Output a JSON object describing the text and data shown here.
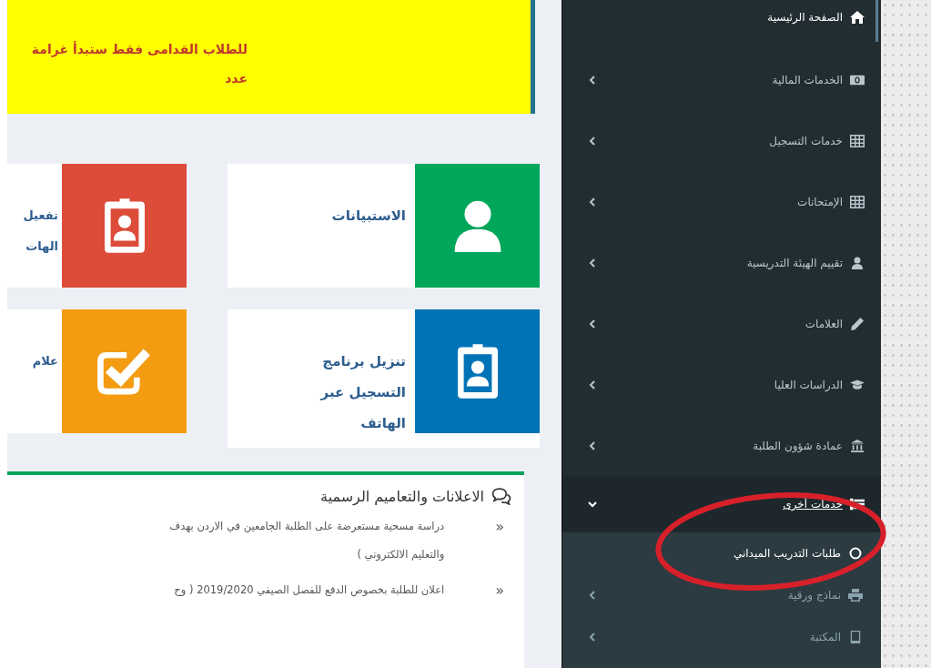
{
  "notice": {
    "lines": [
      "للطلاب القدامى فقط ستبدأ غرامة",
      "عدد"
    ]
  },
  "tile_rows": [
    [
      {
        "lines": [
          "الاستبيانات"
        ],
        "color": "#00a65a"
      },
      {
        "lines": [
          "تفعيل",
          "الهات"
        ],
        "color": "#dd4b39"
      }
    ],
    [
      {
        "lines": [
          "تنزيل برنامج",
          "التسجيل عبر",
          "الهاتف"
        ],
        "color": "#0073b7"
      },
      {
        "lines": [
          "علام"
        ],
        "color": "#f39c12"
      }
    ]
  ],
  "announcements": {
    "title": "الاعلانات والتعاميم الرسمية",
    "items": [
      {
        "bullet": "«",
        "lines": [
          "دراسة مسحية مستعرضة على الطلبة الجامعين في الاردن بهدف",
          "والتعليم الالكتروني )"
        ]
      },
      {
        "bullet": "«",
        "lines": [
          "اعلان للطلبة بخصوص الدفع للفصل الصيفي 2019/2020 ( وح"
        ]
      }
    ]
  },
  "sidebar": {
    "items": [
      {
        "label": "الصفحة الرئيسية",
        "has_arrow": false,
        "expanded": false
      },
      {
        "label": "الخدمات المالية",
        "has_arrow": true,
        "expanded": false
      },
      {
        "label": "خدمات التسجيل",
        "has_arrow": true,
        "expanded": false
      },
      {
        "label": "الإمتحانات",
        "has_arrow": true,
        "expanded": false
      },
      {
        "label": "تقييم الهيئة التدريسية",
        "has_arrow": true,
        "expanded": false
      },
      {
        "label": "العلامات",
        "has_arrow": true,
        "expanded": false
      },
      {
        "label": "الدراسات العليا",
        "has_arrow": true,
        "expanded": false
      },
      {
        "label": "عمادة شؤون الطلبة",
        "has_arrow": true,
        "expanded": false
      },
      {
        "label": "خدمات أخرى",
        "has_arrow": true,
        "expanded": true,
        "children": [
          {
            "label": "طلبات التدريب الميداني",
            "has_arrow": false,
            "selected": true
          },
          {
            "label": "نماذج ورقية",
            "has_arrow": true,
            "selected": false
          },
          {
            "label": "المكتبة",
            "has_arrow": true,
            "selected": false
          }
        ]
      }
    ]
  },
  "annotation": {
    "kind": "ellipse"
  }
}
